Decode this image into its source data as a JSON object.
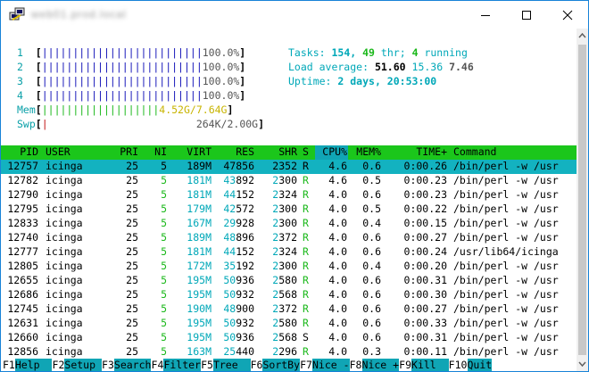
{
  "window": {
    "title": "web01.prod.local",
    "controls": {
      "minimize": "minimize",
      "maximize": "maximize",
      "close": "close"
    }
  },
  "meters": {
    "cpus": [
      {
        "id": "1",
        "bar": "||||||||||||||||||||||||||",
        "pct": "100.0%",
        "level": 1.0
      },
      {
        "id": "2",
        "bar": "||||||||||||||||||||||||||",
        "pct": "100.0%",
        "level": 1.0
      },
      {
        "id": "3",
        "bar": "||||||||||||||||||||||||||",
        "pct": "100.0%",
        "level": 1.0
      },
      {
        "id": "4",
        "bar": "||||||||||||||||||||||||||",
        "pct": "100.0%",
        "level": 1.0
      }
    ],
    "mem": {
      "label": "Mem",
      "bar": "|||||||||||||||||||",
      "value": "4.52G",
      "total": "7.64G"
    },
    "swp": {
      "label": "Swp",
      "bar": "|",
      "value": "264K",
      "total": "2.00G"
    }
  },
  "summary": {
    "tasks_label": "Tasks:",
    "tasks": "154,",
    "thr": "49",
    "thr_label": "thr;",
    "running": "4",
    "running_label": "running",
    "load_label": "Load average:",
    "load1": "51.60",
    "load5": "15.36",
    "load15": "7.46",
    "uptime_label": "Uptime:",
    "uptime": "2 days, 20:53:00"
  },
  "table": {
    "columns": [
      "PID",
      "USER",
      "PRI",
      "NI",
      "VIRT",
      "RES",
      "SHR",
      "S",
      "CPU%",
      "MEM%",
      "TIME+",
      "Command"
    ],
    "rows": [
      [
        "12757",
        "icinga",
        "25",
        "5",
        "189M",
        "47856",
        "2352",
        "R",
        "4.6",
        "0.6",
        "0:00.26",
        "/bin/perl -w /usr"
      ],
      [
        "12782",
        "icinga",
        "25",
        "5",
        "181M",
        "43892",
        "2300",
        "R",
        "4.6",
        "0.5",
        "0:00.23",
        "/bin/perl -w /usr"
      ],
      [
        "12790",
        "icinga",
        "25",
        "5",
        "181M",
        "44152",
        "2324",
        "R",
        "4.0",
        "0.6",
        "0:00.23",
        "/bin/perl -w /usr"
      ],
      [
        "12795",
        "icinga",
        "25",
        "5",
        "179M",
        "42572",
        "2300",
        "R",
        "4.0",
        "0.5",
        "0:00.22",
        "/bin/perl -w /usr"
      ],
      [
        "12833",
        "icinga",
        "25",
        "5",
        "167M",
        "29928",
        "2300",
        "R",
        "4.0",
        "0.4",
        "0:00.15",
        "/bin/perl -w /usr"
      ],
      [
        "12740",
        "icinga",
        "25",
        "5",
        "189M",
        "48896",
        "2372",
        "R",
        "4.0",
        "0.6",
        "0:00.27",
        "/bin/perl -w /usr"
      ],
      [
        "12777",
        "icinga",
        "25",
        "5",
        "181M",
        "44152",
        "2324",
        "R",
        "4.0",
        "0.6",
        "0:00.24",
        "/usr/lib64/icinga"
      ],
      [
        "12805",
        "icinga",
        "25",
        "5",
        "172M",
        "35192",
        "2300",
        "R",
        "4.0",
        "0.4",
        "0:00.20",
        "/bin/perl -w /usr"
      ],
      [
        "12655",
        "icinga",
        "25",
        "5",
        "195M",
        "50936",
        "2580",
        "R",
        "4.0",
        "0.6",
        "0:00.31",
        "/bin/perl -w /usr"
      ],
      [
        "12686",
        "icinga",
        "25",
        "5",
        "195M",
        "50932",
        "2568",
        "R",
        "4.0",
        "0.6",
        "0:00.30",
        "/bin/perl -w /usr"
      ],
      [
        "12745",
        "icinga",
        "25",
        "5",
        "190M",
        "48900",
        "2372",
        "R",
        "4.0",
        "0.6",
        "0:00.27",
        "/bin/perl -w /usr"
      ],
      [
        "12631",
        "icinga",
        "25",
        "5",
        "195M",
        "50932",
        "2580",
        "R",
        "4.0",
        "0.6",
        "0:00.33",
        "/bin/perl -w /usr"
      ],
      [
        "12660",
        "icinga",
        "25",
        "5",
        "195M",
        "50936",
        "2568",
        "S",
        "4.0",
        "0.6",
        "0:00.31",
        "/bin/perl -w /usr"
      ],
      [
        "12856",
        "icinga",
        "25",
        "5",
        "163M",
        "25440",
        "2296",
        "R",
        "4.0",
        "0.3",
        "0:00.11",
        "/bin/perl -w /usr"
      ]
    ]
  },
  "footer": [
    {
      "key": "F1",
      "label": "Help  "
    },
    {
      "key": "F2",
      "label": "Setup "
    },
    {
      "key": "F3",
      "label": "Search"
    },
    {
      "key": "F4",
      "label": "Filter"
    },
    {
      "key": "F5",
      "label": "Tree  "
    },
    {
      "key": "F6",
      "label": "SortBy"
    },
    {
      "key": "F7",
      "label": "Nice -"
    },
    {
      "key": "F8",
      "label": "Nice +"
    },
    {
      "key": "F9",
      "label": "Kill  "
    },
    {
      "key": "F10",
      "label": "Quit"
    }
  ],
  "colors": {
    "header_bg": "#1bc61b",
    "selected_bg": "#13b2c0",
    "accent_cyan": "#00a8b8",
    "window_border": "#1883d7"
  }
}
